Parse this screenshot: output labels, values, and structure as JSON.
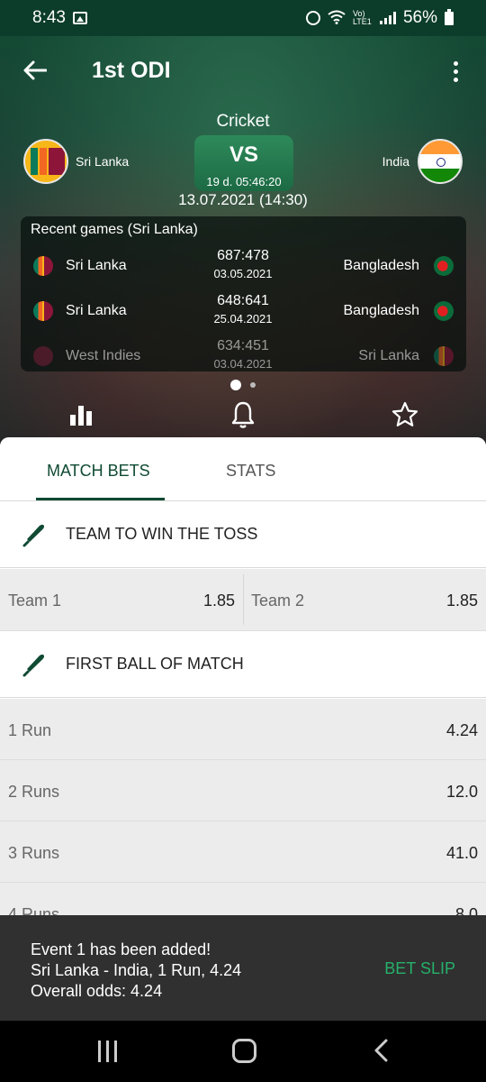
{
  "status_bar": {
    "time": "8:43",
    "battery": "56%",
    "network": "Vo) LTE1"
  },
  "app_bar": {
    "title": "1st ODI"
  },
  "match": {
    "sport": "Cricket",
    "home_team": "Sri Lanka",
    "away_team": "India",
    "vs_label": "VS",
    "countdown": "19 d. 05:46:20",
    "datetime": "13.07.2021 (14:30)"
  },
  "recent_games": {
    "title": "Recent games (Sri Lanka)",
    "rows": [
      {
        "home": "Sri Lanka",
        "score": "687:478",
        "date": "03.05.2021",
        "away": "Bangladesh"
      },
      {
        "home": "Sri Lanka",
        "score": "648:641",
        "date": "25.04.2021",
        "away": "Bangladesh"
      },
      {
        "home": "West Indies",
        "score": "634:451",
        "date": "03.04.2021",
        "away": "Sri Lanka"
      }
    ]
  },
  "tabs": [
    {
      "label": "MATCH BETS",
      "active": true
    },
    {
      "label": "STATS",
      "active": false
    }
  ],
  "markets": [
    {
      "title": "TEAM TO WIN THE TOSS",
      "outcomes": [
        {
          "label": "Team 1",
          "odds": "1.85"
        },
        {
          "label": "Team 2",
          "odds": "1.85"
        }
      ]
    },
    {
      "title": "FIRST BALL OF MATCH",
      "outcomes": [
        {
          "label": "1 Run",
          "odds": "4.24"
        },
        {
          "label": "2 Runs",
          "odds": "12.0"
        },
        {
          "label": "3 Runs",
          "odds": "41.0"
        },
        {
          "label": "4 Runs",
          "odds": "8.0"
        }
      ]
    }
  ],
  "snackbar": {
    "line1": "Event 1 has been added!",
    "line2": "Sri Lanka - India, 1 Run, 4.24",
    "line3": "Overall odds: 4.24",
    "action": "BET SLIP"
  },
  "colors": {
    "brand_dark_green": "#0f4a33",
    "action_green": "#26b06b",
    "snackbar_bg": "#303030"
  },
  "icons": {
    "back": "arrow-back-icon",
    "more": "more-vert-icon",
    "stats": "bar-chart-icon",
    "notifications": "bell-icon",
    "favorite": "star-outline-icon",
    "market": "cricket-bat-icon"
  }
}
